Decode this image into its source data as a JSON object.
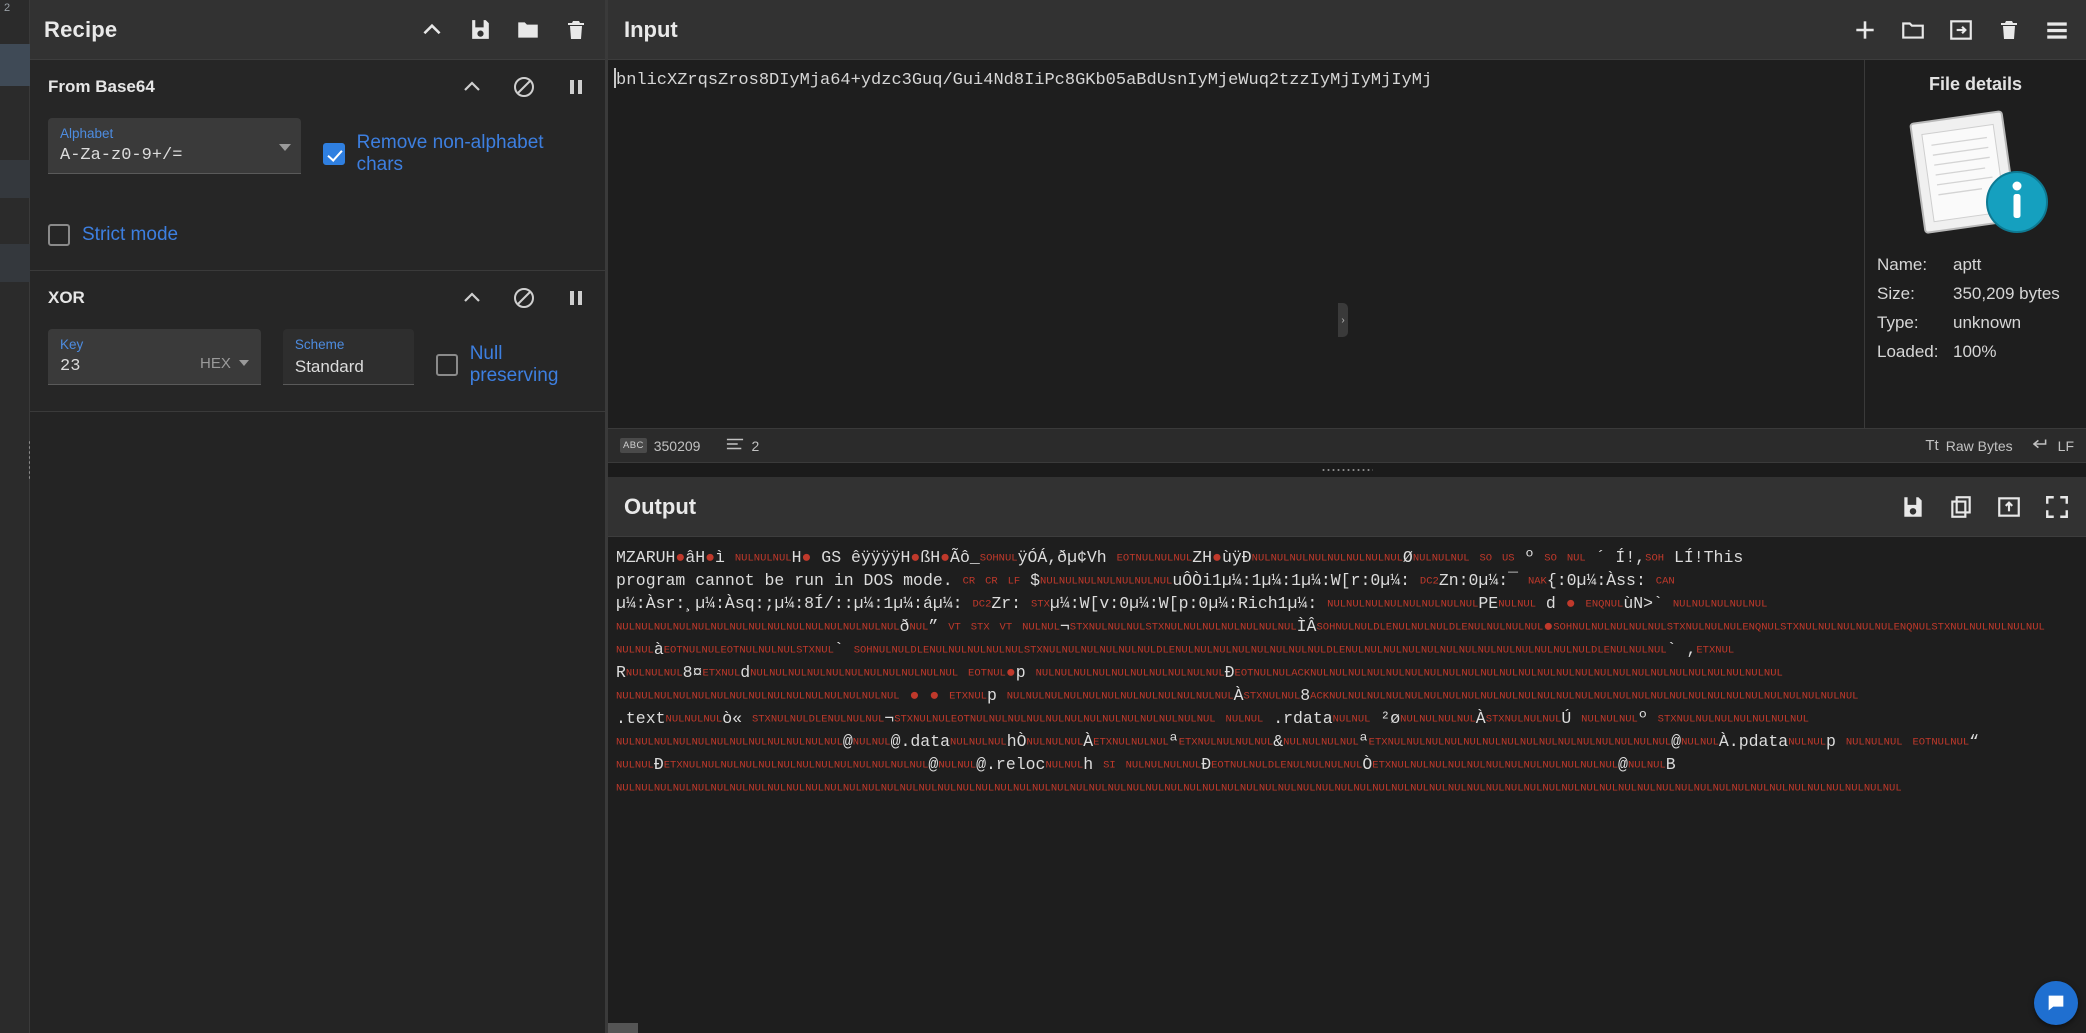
{
  "rail": {
    "label": "2"
  },
  "recipe": {
    "title": "Recipe",
    "icons": [
      "chevron-up-icon",
      "save-icon",
      "folder-icon",
      "trash-icon"
    ],
    "operations": [
      {
        "name": "From Base64",
        "icons": [
          "chevron-up-icon",
          "disable-icon",
          "pause-icon"
        ],
        "args": {
          "alphabet_label": "Alphabet",
          "alphabet_value": "A-Za-z0-9+/=",
          "remove_non_alphabet_label": "Remove non-alphabet chars",
          "remove_non_alphabet_checked": "true",
          "strict_mode_label": "Strict mode",
          "strict_mode_checked": "false"
        }
      },
      {
        "name": "XOR",
        "icons": [
          "chevron-up-icon",
          "disable-icon",
          "pause-icon"
        ],
        "args": {
          "key_label": "Key",
          "key_value": "23",
          "key_unit": "HEX",
          "scheme_label": "Scheme",
          "scheme_value": "Standard",
          "null_preserving_label": "Null preserving",
          "null_preserving_checked": "false"
        }
      }
    ]
  },
  "input": {
    "title": "Input",
    "icons": [
      "add-tab-icon",
      "open-folder-icon",
      "open-file-icon",
      "clear-icon",
      "tabs-icon"
    ],
    "text": "bnlicXZrqsZros8DIyMja64+ydzc3Guq/Gui4Nd8IiPc8GKb05aBdUsnIyMjeWuq2tzzIyMjIyMjIyMj",
    "status": {
      "length_badge": "ABC",
      "length": "350209",
      "lines_badge": "lines-icon",
      "lines": "2",
      "raw_bytes_badge": "Tt",
      "raw_bytes": "Raw Bytes",
      "line_ending_badge": "enter-icon",
      "line_ending": "LF"
    }
  },
  "file_details": {
    "title": "File details",
    "rows": [
      {
        "key": "Name:",
        "value": "aptt"
      },
      {
        "key": "Size:",
        "value": "350,209 bytes"
      },
      {
        "key": "Type:",
        "value": "unknown"
      },
      {
        "key": "Loaded:",
        "value": "100%"
      }
    ]
  },
  "output": {
    "title": "Output",
    "icons": [
      "save-icon",
      "copy-icon",
      "replace-input-icon",
      "maximise-icon"
    ],
    "lines": [
      "MZARUH▪âH▪ì NULNULNULH▪ GS êÿÿÿÿH▪ßH▪Ãô_SOHNULÿÓÁ,ðµ¢Vh EOTNULNULNULZH▪ùÿÐNULNULNULNULNULNULNULNULØNULNULNUL SO US º SO NUL ´ Í!,SOH LÍ!This",
      "program cannot be run in DOS mode. CR CR LF $NULNULNULNULNULNULNULuÔÒi1µ¼:1µ¼:1µ¼:W[r:0µ¼: DC2Zn:0µ¼:¯ NAK{:0µ¼:Àss: CAN",
      "µ¼:Àsr:¸µ¼:Àsq:;µ¼:8Í/::µ¼:1µ¼:áµ¼: DC2Zr: STXµ¼:W[v:0µ¼:W[p:0µ¼:Rich1µ¼: NULNULNULNULNULNULNULNULPENULNUL d ▪ ENQNULùN>` NULNULNULNULNUL",
      "NULNULNULNULNULNULNULNULNULNULNULNULNULNULNULðNUL” VT STX VT NULNUL¬STXNULNULNULSTXNULNULNULNULNULNULNULÌÂSOHNULNULDLENULNULNULDLENULNULNULNUL▪SOHNULNULNULNULNULSTXNULNULNULENQNULSTXNULNULNULNULNULENQNULSTXNULNULNULNULNUL",
      "NULNULàEOTNULNULEOTNULNULNULSTXNUL` SOHNULNULDLENULNULNULNULNULSTXNULNULNULNULNULNULDLENULNULNULNULNULNULNULNULDLENULNULNULNULNULNULNULNULNULNULNULNULNULDLENULNULNUL` ,ETXNUL",
      "RNULNULNUL8¤ETXNULdNULNULNULNULNULNULNULNULNULNULNUL  EOTNUL▪p   NULNULNULNULNULNULNULNULNULNULÐEOTNULNULACKNULNULNULNULNULNULNULNULNULNULNULNULNULNULNULNULNULNULNULNULNULNULNULNULNUL",
      "NULNULNULNULNULNULNULNULNULNULNULNULNULNULNUL ▪ ▪ ETXNULp NULNULNULNULNULNULNULNULNULNULNULNULÀSTXNULNUL8ACKNULNULNULNULNULNULNULNULNULNULNULNULNULNULNULNULNULNULNULNULNULNULNULNULNULNULNULNUL",
      ".textNULNULNULò« STXNULNULDLENULNULNUL¬STXNULNULEOTNULNULNULNULNULNULNULNULNULNULNULNULNUL  NULNUL .rdataNULNUL ²øNULNULNULNULÀSTXNULNULNULÚ NULNULNULº STXNULNULNULNULNULNULNUL",
      "NULNULNULNULNULNULNULNULNULNULNULNUL@NULNUL@.dataNULNULNULhÒNULNULNULÀETXNULNULNULªETXNULNULNULNUL&NULNULNULNULªETXNULNULNULNULNULNULNULNULNULNULNULNULNULNULNUL@NULNULÀ.pdataNULNULp NULNULNUL  EOTNULNUL“",
      "NULNULÐETXNULNULNULNULNULNULNULNULNULNULNULNULNUL@NULNUL@.relocNULNULh SI NULNULNULNULÐEOTNULNULDLENULNULNULNULÒETXNULNULNULNULNULNULNULNULNULNULNULNUL@NULNULB",
      "NULNULNULNULNULNULNULNULNULNULNULNULNULNULNULNULNULNULNULNULNULNULNULNULNULNULNULNULNULNULNULNULNULNULNULNULNULNULNULNULNULNULNULNULNULNULNULNULNULNULNULNULNULNULNULNULNULNULNULNULNULNULNULNULNULNULNULNUL"
    ]
  },
  "chat": {
    "icon": "chat-icon"
  }
}
